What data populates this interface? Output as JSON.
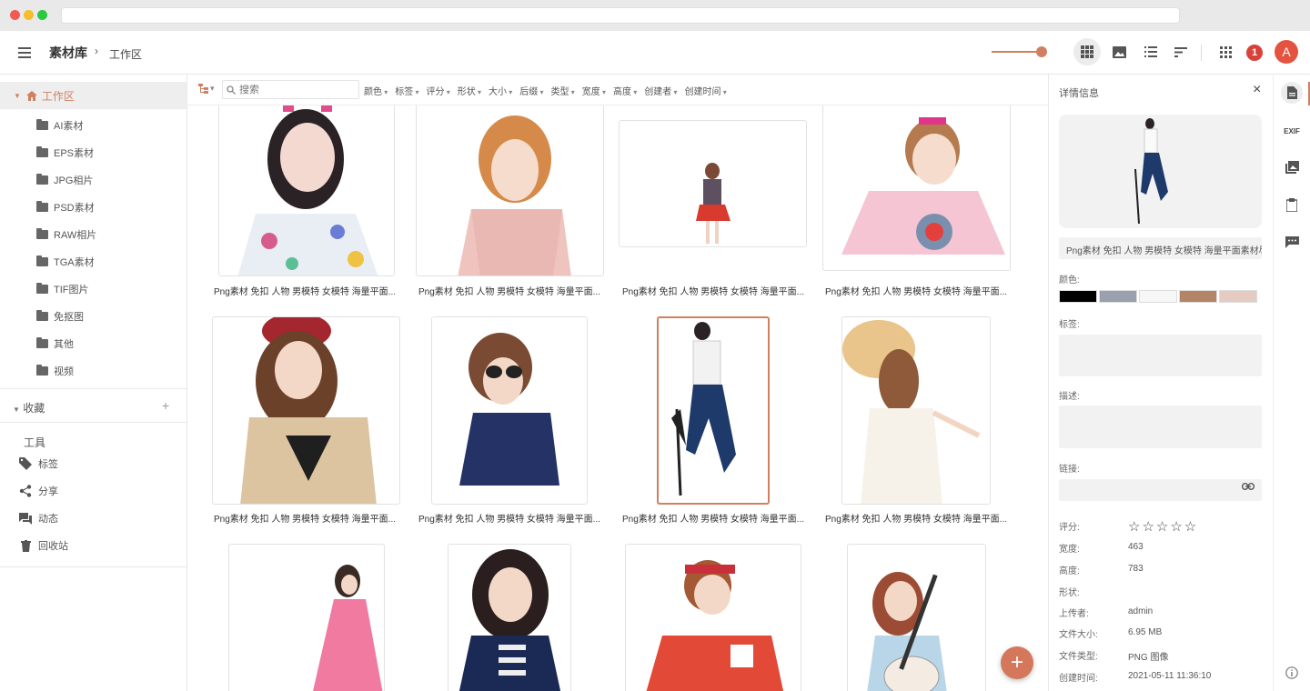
{
  "app": {
    "title": "素材库",
    "breadcrumb_sep": "›",
    "breadcrumb": "工作区",
    "notification_count": "1",
    "avatar_letter": "A",
    "accent_color": "#d08060"
  },
  "sidebar": {
    "root_label": "工作区",
    "folders": [
      "AI素材",
      "EPS素材",
      "JPG相片",
      "PSD素材",
      "RAW相片",
      "TGA素材",
      "TIF图片",
      "免抠图",
      "其他",
      "视频"
    ],
    "favorites_label": "收藏",
    "favorites_add": "+",
    "tools_label": "工具",
    "tools": [
      {
        "label": "标签",
        "icon": "tag-icon"
      },
      {
        "label": "分享",
        "icon": "share-icon"
      },
      {
        "label": "动态",
        "icon": "chat-icon"
      },
      {
        "label": "回收站",
        "icon": "trash-icon"
      }
    ]
  },
  "filterbar": {
    "search_placeholder": "搜索",
    "filters": [
      "颜色",
      "标签",
      "评分",
      "形状",
      "大小",
      "后缀",
      "类型",
      "宽度",
      "高度",
      "创建者",
      "创建时间"
    ]
  },
  "grid": {
    "caption": "Png素材 免扣 人物 男模特 女模特 海量平面...",
    "items": [
      {
        "caption": "Png素材 免扣 人物 男模特 女模特 海量平面...",
        "selected": false
      },
      {
        "caption": "Png素材 免扣 人物 男模特 女模特 海量平面...",
        "selected": false
      },
      {
        "caption": "Png素材 免扣 人物 男模特 女模特 海量平面...",
        "selected": false
      },
      {
        "caption": "Png素材 免扣 人物 男模特 女模特 海量平面...",
        "selected": false
      },
      {
        "caption": "Png素材 免扣 人物 男模特 女模特 海量平面...",
        "selected": false
      },
      {
        "caption": "Png素材 免扣 人物 男模特 女模特 海量平面...",
        "selected": false
      },
      {
        "caption": "Png素材 免扣 人物 男模特 女模特 海量平面...",
        "selected": true
      },
      {
        "caption": "Png素材 免扣 人物 男模特 女模特 海量平面...",
        "selected": false
      },
      {
        "caption": "",
        "selected": false
      },
      {
        "caption": "",
        "selected": false
      },
      {
        "caption": "",
        "selected": false
      },
      {
        "caption": "",
        "selected": false
      }
    ]
  },
  "detail": {
    "title": "详情信息",
    "close": "×",
    "name": "Png素材 免扣 人物 男模特 女模特 海量平面素材尽在",
    "color_label": "颜色:",
    "colors": [
      "#000000",
      "#9aa0ad",
      "#f7f7f7",
      "#b48467",
      "#e6cbc2"
    ],
    "tags_label": "标签:",
    "desc_label": "描述:",
    "link_label": "链接:",
    "rating_label": "评分:",
    "rating": "☆☆☆☆☆",
    "width_label": "宽度:",
    "width": "463",
    "height_label": "高度:",
    "height": "783",
    "shape_label": "形状:",
    "uploader_label": "上传者:",
    "uploader": "admin",
    "size_label": "文件大小:",
    "size": "6.95 MB",
    "type_label": "文件类型:",
    "type": "PNG 图像",
    "created_label": "创建时间:",
    "created": "2021-05-11 11:36:10"
  },
  "rail": {
    "exif_label": "EXIF"
  },
  "fab": {
    "label": "+"
  }
}
